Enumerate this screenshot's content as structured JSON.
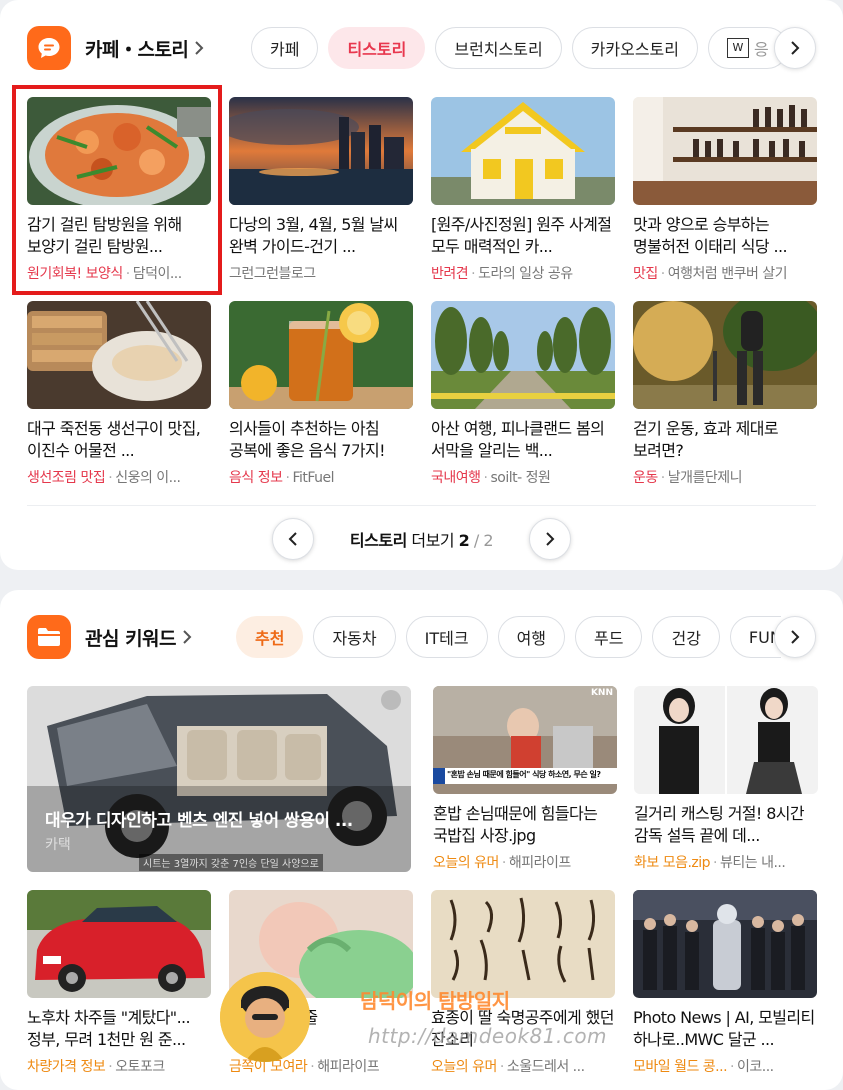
{
  "cafe_story": {
    "title": "카페・스토리",
    "tabs": [
      "카페",
      "티스토리",
      "브런치스토리",
      "카카오스토리",
      "응"
    ],
    "cards": [
      {
        "title": "감기 걸린 탐방원을 위해 보양기 걸린 탐방원...",
        "category": "원기회복! 보양식",
        "source": "담덕이..."
      },
      {
        "title": "다낭의 3월, 4월, 5월 날씨 완벽 가이드-건기 ...",
        "category": "",
        "source": "그런그런블로그"
      },
      {
        "title": "[원주/사진정원] 원주 사계절 모두 매력적인 카...",
        "category": "반려견",
        "source": "도라의 일상 공유"
      },
      {
        "title": "맛과 양으로 승부하는 명불허전 이태리 식당 ...",
        "category": "맛집",
        "source": "여행처럼 밴쿠버 살기"
      },
      {
        "title": "대구 죽전동 생선구이 맛집, 이진수 어물전 ...",
        "category": "생선조림 맛집",
        "source": "신웅의 이..."
      },
      {
        "title": "의사들이 추천하는 아침 공복에 좋은 음식 7가지!",
        "category": "음식 정보",
        "source": "FitFuel"
      },
      {
        "title": "아산 여행, 피나클랜드 봄의 서막을 알리는 백...",
        "category": "국내여행",
        "source": "soilt- 정원"
      },
      {
        "title": "걷기 운동, 효과 제대로 보려면?",
        "category": "운동",
        "source": "날개를단제니"
      }
    ],
    "pager": {
      "label": "티스토리",
      "more": "더보기",
      "current": "2",
      "slash": "/",
      "total": "2"
    }
  },
  "keywords": {
    "title": "관심 키워드",
    "tabs": [
      "추천",
      "자동차",
      "IT테크",
      "여행",
      "푸드",
      "건강",
      "FUN"
    ],
    "big_card": {
      "title": "대우가 디자인하고 벤츠 엔진 넣어 쌍용이 ...",
      "source": "카택",
      "caption": "시트는 3열까지 갖춘 7인승 단일 사양으로"
    },
    "cards": [
      {
        "title": "혼밥 손님때문에 힘들다는 국밥집 사장.jpg",
        "category": "오늘의 유머",
        "source": "해피라이프"
      },
      {
        "title": "길거리 캐스팅 거절! 8시간 감독 설득 끝에 데...",
        "category": "화보 모음.zip",
        "source": "뷰티는 내..."
      },
      {
        "title": "노후차 차주들 \"계탔다\"... 정부, 무려 1천만 원 준...",
        "category": "차량가격 정보",
        "source": "오토포크"
      },
      {
        "title": "...가 뱃속인줄",
        "category": "금쪽이 모여라",
        "source": "해피라이프"
      },
      {
        "title": "효종이 딸 숙명공주에게 했던 잔소리",
        "category": "오늘의 유머",
        "source": "소울드레서 ..."
      },
      {
        "title": "Photo News | AI, 모빌리티 하나로..MWC 달군 ...",
        "category": "모바일 월드 콩...",
        "source": "이코..."
      }
    ],
    "thumb_texts": {
      "knn": "KNN",
      "news_caption": "\"혼밥 손님 때문에 힘들어\" 식당 하소연, 무슨 일?"
    }
  },
  "watermark": {
    "text": "담덕이의 탐방일지",
    "url": "http://damdeok81.com"
  },
  "colors": {
    "brand_orange": "#ff6a1a",
    "highlight": "#e41b1b",
    "category_pink": "#e5384c",
    "category_orange": "#ee8a12"
  }
}
